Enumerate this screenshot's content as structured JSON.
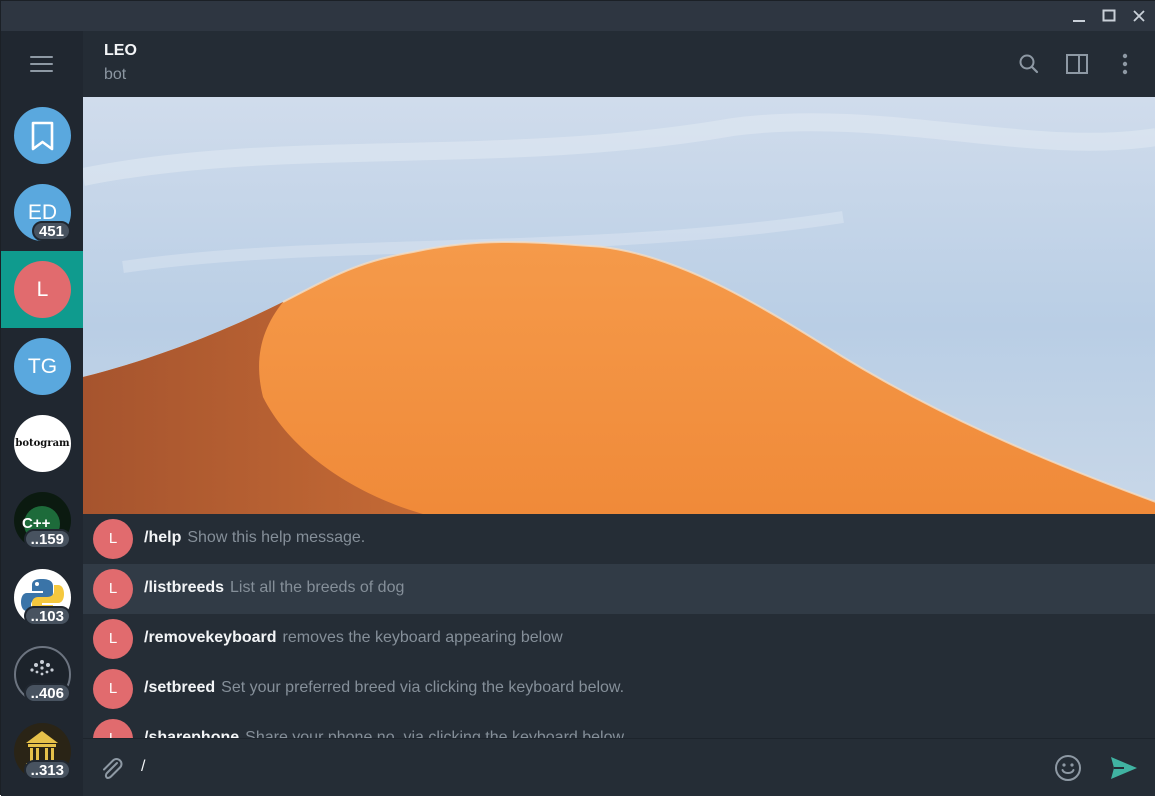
{
  "window": {
    "minimize_icon": "minimize-icon",
    "maximize_icon": "maximize-icon",
    "close_icon": "close-icon"
  },
  "sidebar": {
    "menu_icon": "hamburger-menu-icon",
    "chats": [
      {
        "id": "saved",
        "initials": "",
        "icon": "bookmark-icon",
        "color": "#5aa8de",
        "badge": ""
      },
      {
        "id": "ed",
        "initials": "ED",
        "color": "#5aa8de",
        "badge": "451"
      },
      {
        "id": "leo",
        "initials": "L",
        "color": "#e16b6e",
        "badge": "",
        "active": true
      },
      {
        "id": "tg",
        "initials": "TG",
        "color": "#5aa8de",
        "badge": ""
      },
      {
        "id": "botogram",
        "initials": "botogram",
        "color": "#ffffff",
        "badge": ""
      },
      {
        "id": "cpp",
        "initials": "C++",
        "color": "#0b1a10",
        "badge": "..159"
      },
      {
        "id": "python",
        "initials": "",
        "color": "#ffffff",
        "badge": "..103"
      },
      {
        "id": "iota",
        "initials": "",
        "color": "#1c232b",
        "badge": "..406"
      },
      {
        "id": "temple",
        "initials": "",
        "color": "#2a2416",
        "badge": "..313"
      }
    ]
  },
  "header": {
    "title": "LEO",
    "status": "bot",
    "search_icon": "search-icon",
    "sidebar_toggle_icon": "sidebar-toggle-icon",
    "more_icon": "more-vertical-icon"
  },
  "commands": [
    {
      "avatar": "L",
      "name": "/help",
      "description": "Show this help message."
    },
    {
      "avatar": "L",
      "name": "/listbreeds",
      "description": "List all the breeds of dog"
    },
    {
      "avatar": "L",
      "name": "/removekeyboard",
      "description": "removes the keyboard appearing below"
    },
    {
      "avatar": "L",
      "name": "/setbreed",
      "description": "Set your preferred breed via clicking the keyboard below."
    },
    {
      "avatar": "L",
      "name": "/sharephone",
      "description": "Share your phone no. via clicking the keyboard below."
    }
  ],
  "composer": {
    "value": "/",
    "attach_icon": "paperclip-icon",
    "emoji_icon": "emoji-icon",
    "send_icon": "send-icon"
  },
  "colors": {
    "accent": "#0f9b8e",
    "send": "#40b3a2",
    "sidebar_bg": "#202730",
    "header_bg": "#242c35"
  }
}
